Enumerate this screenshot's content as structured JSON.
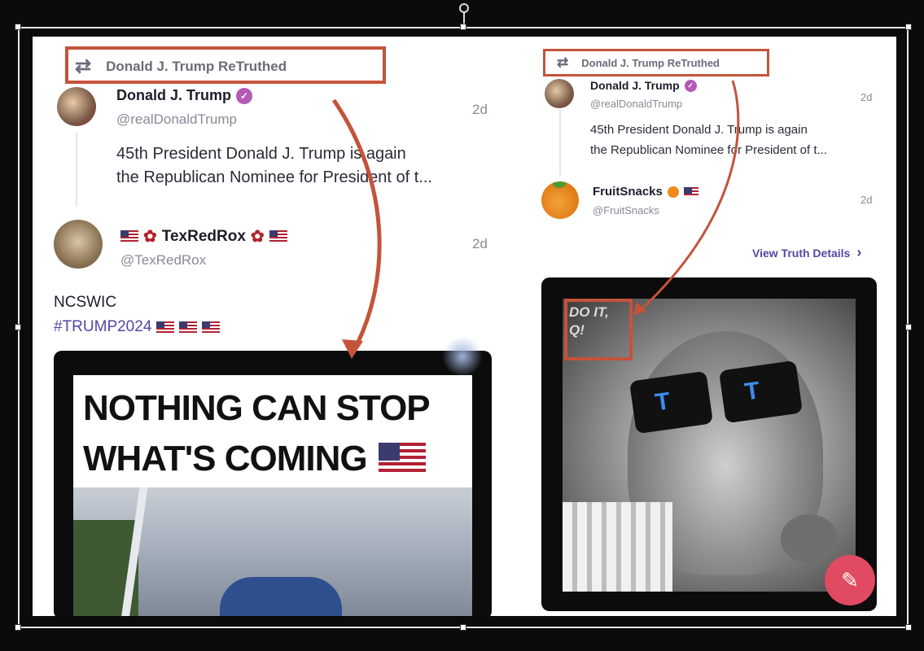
{
  "left_post": {
    "retruth_label": "Donald J. Trump ReTruthed",
    "original": {
      "name": "Donald J. Trump",
      "handle": "@realDonaldTrump",
      "time": "2d",
      "text_line1": "45th President Donald J. Trump is again",
      "text_line2": "the Republican Nominee for President of t..."
    },
    "reply": {
      "name": "TexRedRox",
      "handle": "@TexRedRox",
      "time": "2d",
      "body": "NCSWIC",
      "hashtag": "#TRUMP2024"
    },
    "media_caption_line1": "NOTHING CAN STOP",
    "media_caption_line2": "WHAT'S COMING"
  },
  "right_post": {
    "retruth_label": "Donald J. Trump ReTruthed",
    "original": {
      "name": "Donald J. Trump",
      "handle": "@realDonaldTrump",
      "time": "2d",
      "text_line1": "45th President Donald J. Trump is again",
      "text_line2": "the Republican Nominee for President of t..."
    },
    "reply": {
      "name": "FruitSnacks",
      "handle": "@FruitSnacks",
      "time": "2d"
    },
    "view_details_label": "View Truth Details",
    "watermark": "DO IT, Q!"
  },
  "annotation_color": "#c4533a",
  "accent_color": "#5447a6"
}
